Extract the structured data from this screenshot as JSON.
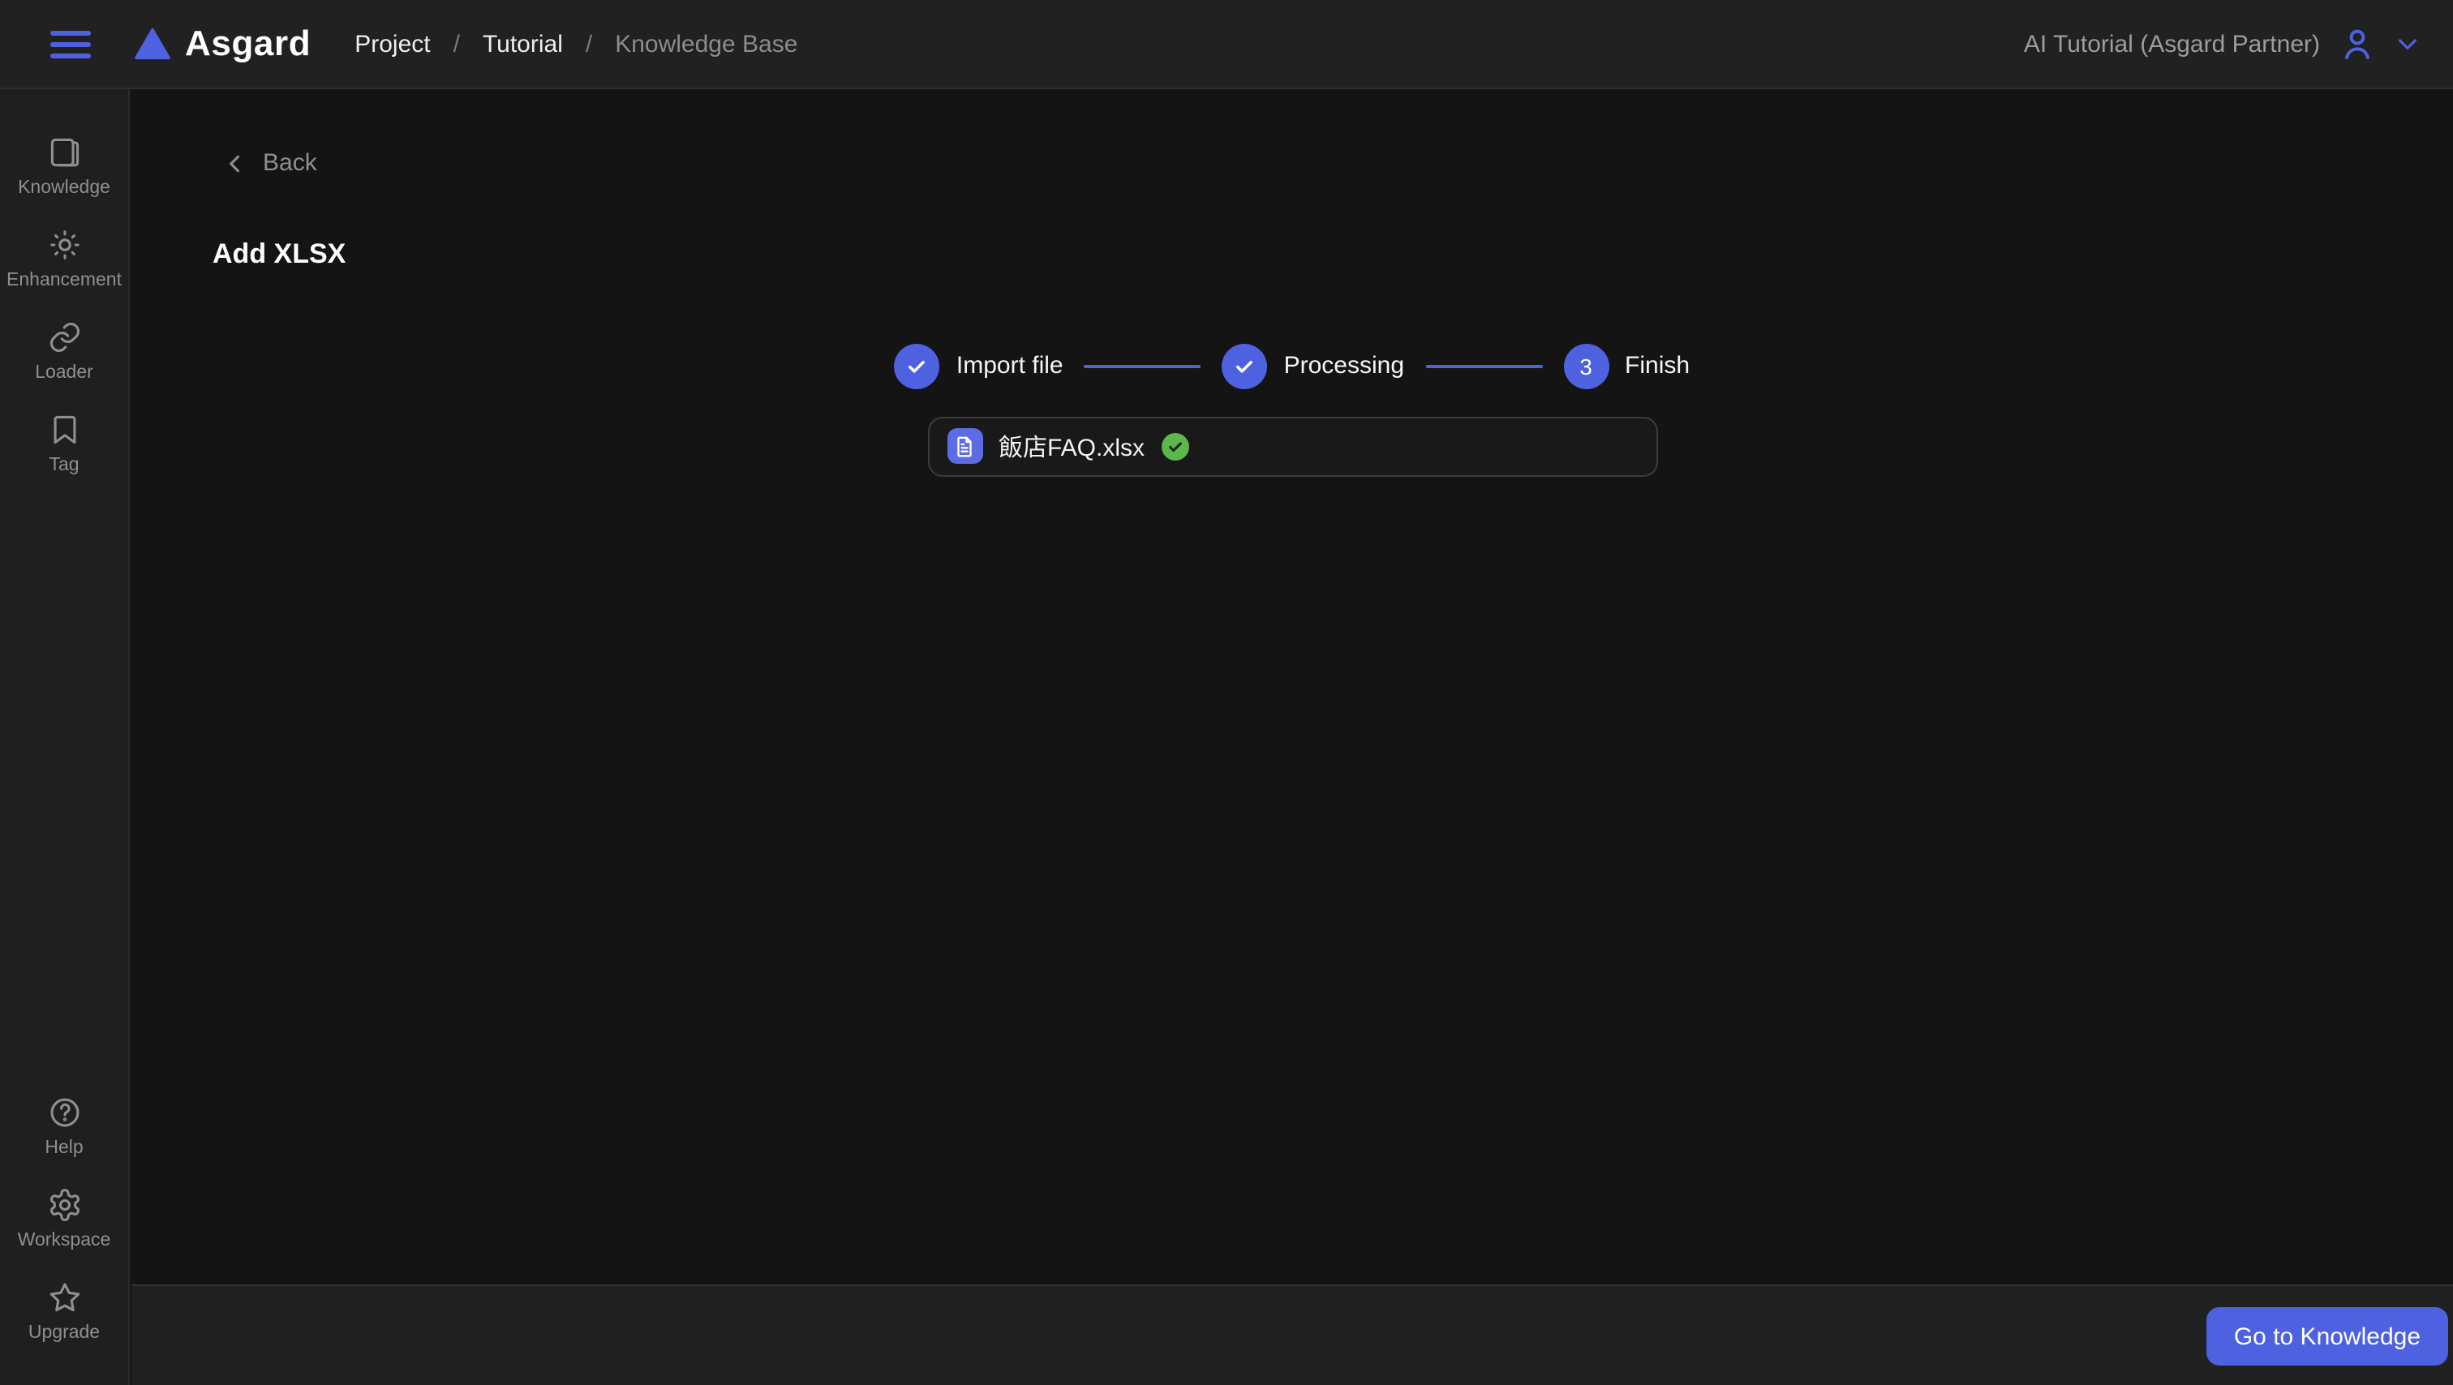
{
  "colors": {
    "accent_blue": "#4d61e1",
    "success_green": "#5cb84c",
    "topbar_bg": "#212121",
    "sidebar_bg": "#1f1f1f",
    "content_bg": "#141414"
  },
  "topbar": {
    "brand": "Asgard",
    "breadcrumb": {
      "items": [
        "Project",
        "Tutorial",
        "Knowledge Base"
      ],
      "separator": "/"
    },
    "account_label": "AI Tutorial (Asgard Partner)"
  },
  "sidebar": {
    "top_items": [
      {
        "label": "Knowledge",
        "icon": "book-icon"
      },
      {
        "label": "Enhancement",
        "icon": "sun-icon"
      },
      {
        "label": "Loader",
        "icon": "link-icon"
      },
      {
        "label": "Tag",
        "icon": "bookmark-icon"
      }
    ],
    "bottom_items": [
      {
        "label": "Help",
        "icon": "help-icon"
      },
      {
        "label": "Workspace",
        "icon": "gear-icon"
      },
      {
        "label": "Upgrade",
        "icon": "star-icon"
      }
    ]
  },
  "main": {
    "back_label": "Back",
    "title": "Add XLSX",
    "steps": [
      {
        "label": "Import file",
        "state": "done"
      },
      {
        "label": "Processing",
        "state": "done"
      },
      {
        "label": "Finish",
        "number": "3",
        "state": "active"
      }
    ],
    "file": {
      "name": "飯店FAQ.xlsx",
      "status": "success"
    }
  },
  "footer": {
    "go_button_label": "Go to Knowledge"
  }
}
